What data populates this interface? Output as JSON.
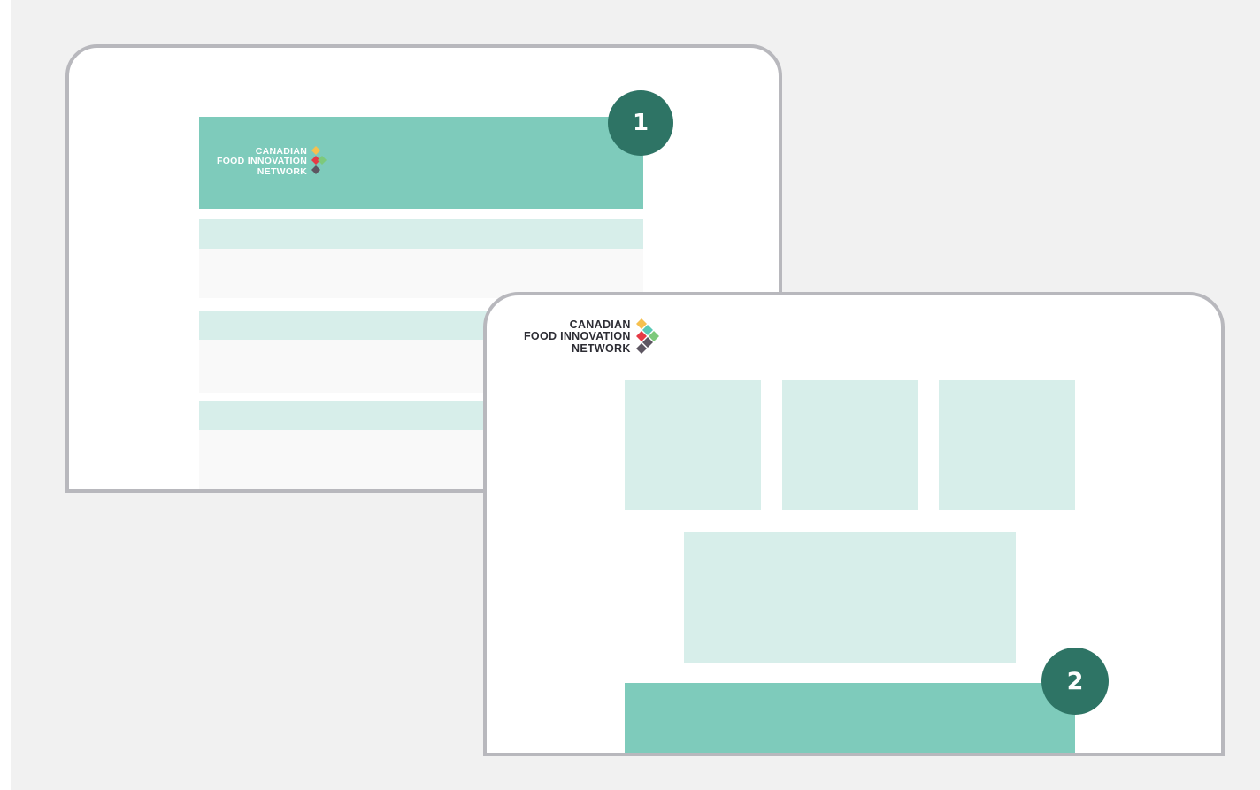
{
  "brand": {
    "line1": "CANADIAN",
    "line2": "FOOD INNOVATION",
    "line3": "NETWORK",
    "mark_colors": {
      "top": "#f6c04f",
      "middle_left": "#e53a45",
      "middle_right": "#7dc97b",
      "bottom": "#5d5661",
      "accent": "#5ac9b5"
    }
  },
  "layout_1": {
    "badge": "1"
  },
  "layout_2": {
    "badge": "2"
  },
  "colors": {
    "canvas": "#f1f1f1",
    "frame_border": "#b8b8bd",
    "teal_dark": "#7ecbbb",
    "teal_light": "#d7eeea",
    "badge": "#2e7465"
  }
}
